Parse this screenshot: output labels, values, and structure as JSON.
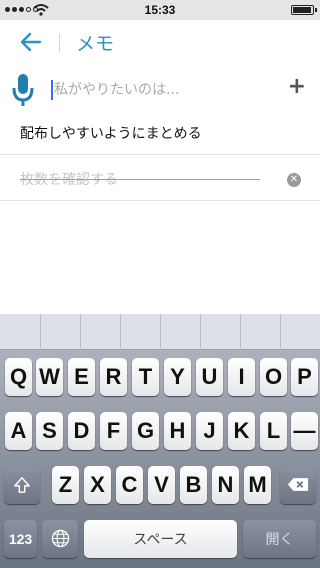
{
  "statusbar": {
    "time": "15:33"
  },
  "navbar": {
    "title": "メモ"
  },
  "input": {
    "placeholder": "私がやりたいのは...",
    "add_label": "+"
  },
  "items": [
    {
      "text": "配布しやすいようにまとめる",
      "done": false
    },
    {
      "text": "枚数を確認する",
      "done": true
    }
  ],
  "keyboard": {
    "row1": [
      "Q",
      "W",
      "E",
      "R",
      "T",
      "Y",
      "U",
      "I",
      "O",
      "P"
    ],
    "row2": [
      "A",
      "S",
      "D",
      "F",
      "G",
      "H",
      "J",
      "K",
      "L",
      "—"
    ],
    "row3": [
      "Z",
      "X",
      "C",
      "V",
      "B",
      "N",
      "M"
    ],
    "numbers_label": "123",
    "space_label": "スペース",
    "open_label": "開く"
  },
  "colors": {
    "accent": "#2a93c6",
    "mic": "#1e7fb0"
  }
}
